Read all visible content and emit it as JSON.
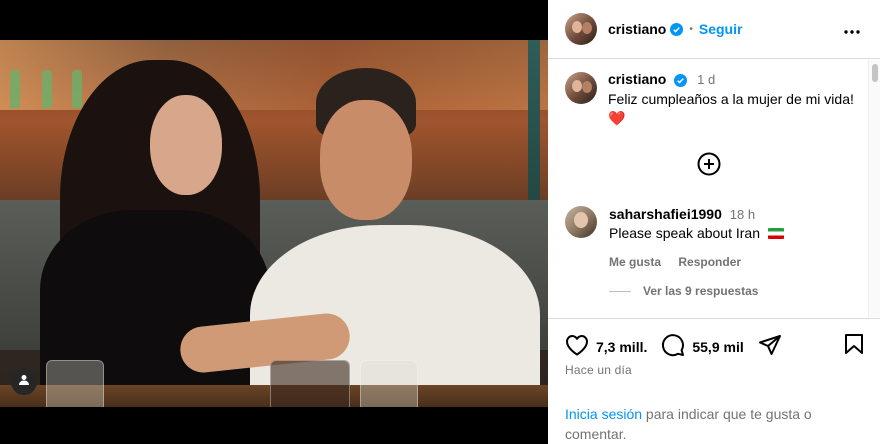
{
  "header": {
    "username": "cristiano",
    "separator": "•",
    "follow_label": "Seguir"
  },
  "post": {
    "username": "cristiano",
    "time": "1 d",
    "caption": "Feliz cumpleaños a la mujer de mi vida!",
    "caption_emoji": "❤️"
  },
  "comments": [
    {
      "username": "saharshafiei1990",
      "time": "18 h",
      "text": "Please speak about Iran",
      "like_label": "Me gusta",
      "reply_label": "Responder",
      "view_replies_label": "Ver las 9 respuestas"
    }
  ],
  "actions": {
    "likes": "7,3 mill.",
    "comments_count": "55,9 mil"
  },
  "posted_ago": "Hace un día",
  "login_prompt": {
    "link": "Inicia sesión",
    "rest": " para indicar que te gusta o comentar."
  },
  "colors": {
    "accent": "#0095f6",
    "verified": "#0095f6",
    "muted_text": "#737373",
    "divider": "#dbdbdb"
  },
  "icons": [
    "user-tag-icon",
    "verified-badge-icon",
    "more-options-icon",
    "add-circle-icon",
    "heart-icon",
    "comment-icon",
    "share-icon",
    "bookmark-icon"
  ]
}
